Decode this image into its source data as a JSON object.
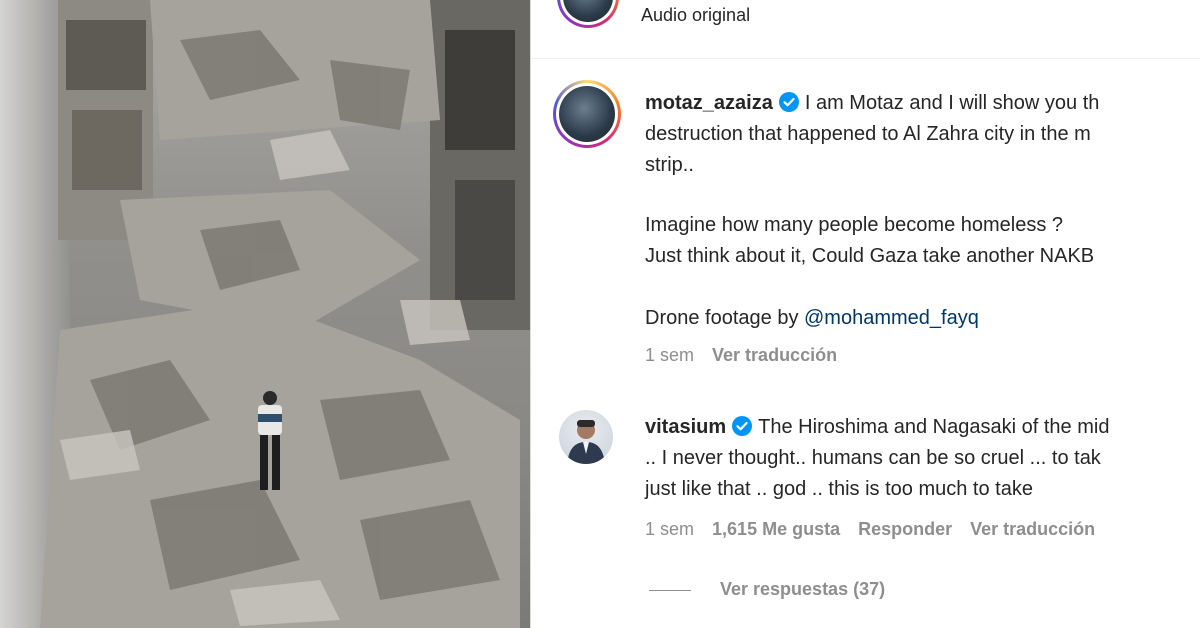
{
  "audio": {
    "label": "Audio original"
  },
  "caption": {
    "username": "motaz_azaiza",
    "lines": [
      "I am Motaz and I will show you th",
      "destruction that happened to Al Zahra city in the m",
      "strip..",
      "",
      "Imagine how many people become homeless ?",
      "Just think about it, Could Gaza take another NAKB",
      "",
      "Drone footage by"
    ],
    "mention": "@mohammed_fayq",
    "time": "1 sem",
    "translate": "Ver traducción"
  },
  "comment": {
    "username": "vitasium",
    "lines": [
      "The Hiroshima and Nagasaki of the mid",
      ".. I never thought.. humans can be so cruel ... to tak",
      "just like that .. god .. this is too much to take"
    ],
    "time": "1 sem",
    "likes": "1,615 Me gusta",
    "reply": "Responder",
    "translate": "Ver traducción",
    "view_replies": "Ver respuestas (37)"
  },
  "colors": {
    "verified": "#0095f6",
    "meta": "#8e8e8e",
    "link": "#00376b"
  }
}
